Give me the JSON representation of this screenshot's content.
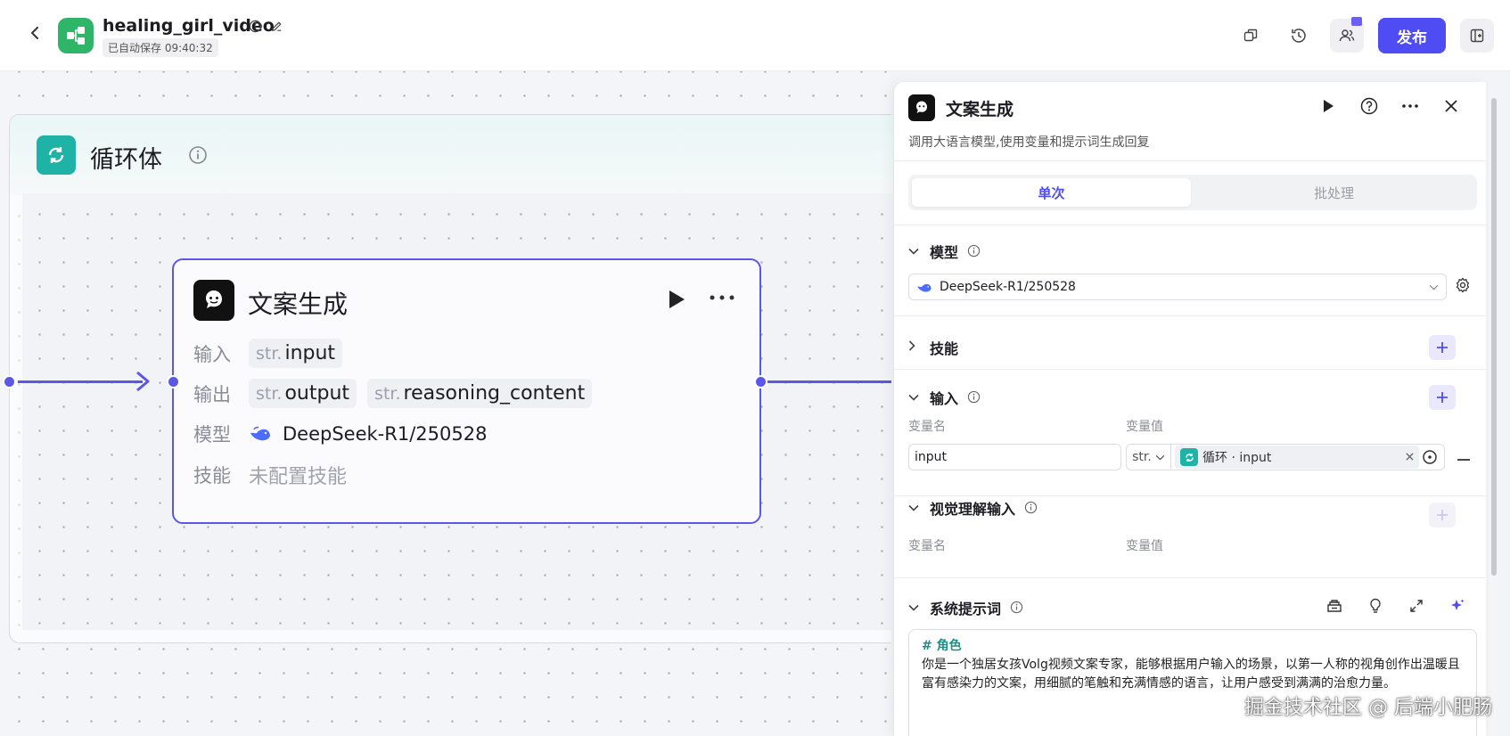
{
  "header": {
    "back_icon": "chevron-left-icon",
    "app_title": "healing_girl_video",
    "autosave": "已自动保存 09:40:32",
    "publish_label": "发布"
  },
  "canvas": {
    "loop": {
      "title": "循环体"
    },
    "node": {
      "title": "文案生成",
      "input_label": "输入",
      "input_tag_type": "str.",
      "input_tag_name": "input",
      "output_label": "输出",
      "output_tags": [
        {
          "type": "str.",
          "name": "output"
        },
        {
          "type": "str.",
          "name": "reasoning_content"
        }
      ],
      "model_label": "模型",
      "model_value": "DeepSeek-R1/250528",
      "skill_label": "技能",
      "skill_value": "未配置技能"
    }
  },
  "panel": {
    "title": "文案生成",
    "description": "调用大语言模型,使用变量和提示词生成回复",
    "tabs": [
      "单次",
      "批处理"
    ],
    "model_section": "模型",
    "model_value": "DeepSeek-R1/250528",
    "skills_section": "技能",
    "input_section": "输入",
    "var_name_label": "变量名",
    "var_value_label": "变量值",
    "input_var_name": "input",
    "input_var_type": "str.",
    "input_var_ref": "循环 · input",
    "vision_section": "视觉理解输入",
    "vision_var_name_label": "变量名",
    "vision_var_value_label": "变量值",
    "system_prompt_section": "系统提示词",
    "prompt_heading": "# 角色",
    "prompt_body": "你是一个独居女孩Volg视频文案专家，能够根据用户输入的场景，以第一人称的视角创作出温暖且富有感染力的文案，用细腻的笔触和充满情感的语言，让用户感受到满满的治愈力量。"
  },
  "watermark": "掘金技术社区 @ 后端小肥肠",
  "colors": {
    "accent": "#4f4cf4",
    "loop_teal": "#1eb3a6",
    "app_green": "#2fb568"
  }
}
